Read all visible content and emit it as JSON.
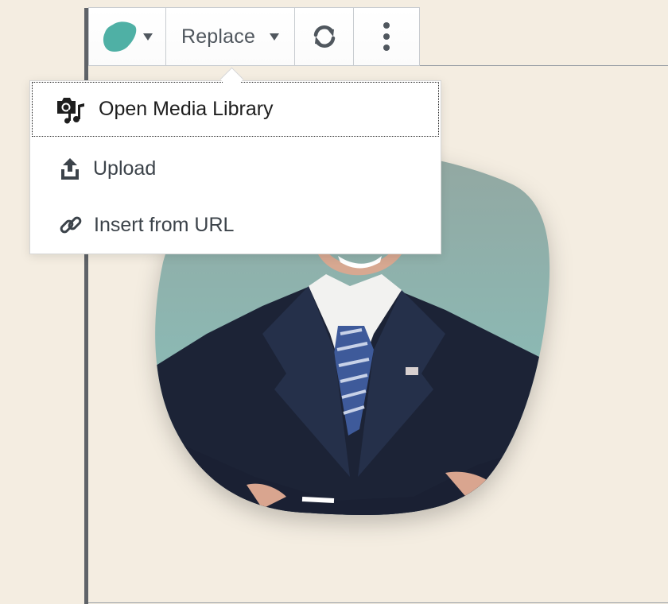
{
  "toolbar": {
    "shape_button": {
      "icon": "blob-shape-icon",
      "color": "#4fb0a5"
    },
    "replace_label": "Replace",
    "refresh_icon": "refresh-icon",
    "more_icon": "more-vertical-icon"
  },
  "replace_menu": {
    "items": [
      {
        "label": "Open Media Library",
        "icon": "media-library-icon"
      },
      {
        "label": "Upload",
        "icon": "upload-icon"
      },
      {
        "label": "Insert from URL",
        "icon": "link-icon"
      }
    ]
  },
  "colors": {
    "background": "#f4ede1",
    "accent": "#4fb0a5"
  }
}
